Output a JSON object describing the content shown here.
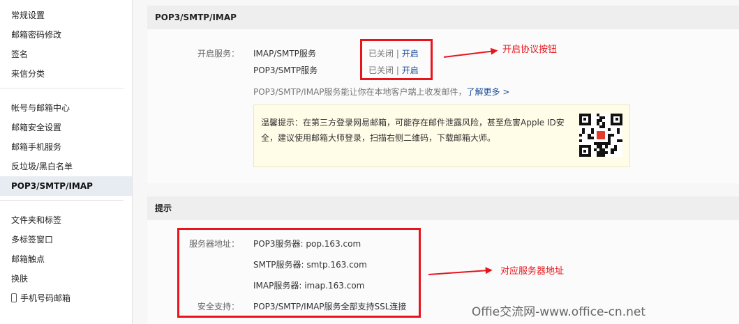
{
  "sidebar": {
    "group1": [
      "常规设置",
      "邮箱密码修改",
      "签名",
      "来信分类"
    ],
    "group2": [
      "帐号与邮箱中心",
      "邮箱安全设置",
      "邮箱手机服务",
      "反垃圾/黑白名单",
      "POP3/SMTP/IMAP"
    ],
    "group3": [
      "文件夹和标签",
      "多标签窗口",
      "邮箱触点",
      "换肤",
      "手机号码邮箱"
    ]
  },
  "pop_section": {
    "title": "POP3/SMTP/IMAP",
    "open_service_label": "开启服务：",
    "services": [
      {
        "name": "IMAP/SMTP服务",
        "status": "已关闭",
        "sep": "|",
        "action": "开启"
      },
      {
        "name": "POP3/SMTP服务",
        "status": "已关闭",
        "sep": "|",
        "action": "开启"
      }
    ],
    "desc": "POP3/SMTP/IMAP服务能让你在本地客户端上收发邮件，",
    "learn_more": "了解更多 >",
    "tip": "温馨提示：在第三方登录网易邮箱，可能存在邮件泄露风险，甚至危害Apple ID安全，建议使用邮箱大师登录，扫描右侧二维码，下载邮箱大师。"
  },
  "hint_section": {
    "title": "提示",
    "server_label": "服务器地址：",
    "servers": [
      "POP3服务器: pop.163.com",
      "SMTP服务器: smtp.163.com",
      "IMAP服务器: imap.163.com"
    ],
    "security_label": "安全支持：",
    "security_value": "POP3/SMTP/IMAP服务全部支持SSL连接"
  },
  "annotations": {
    "open_protocol": "开启协议按钮",
    "server_address": "对应服务器地址"
  },
  "watermark": "Offie交流网-www.office-cn.net",
  "colors": {
    "annotation_red": "#e8141b",
    "link_blue": "#1a4e9a",
    "sidebar_active_bg": "#e6ecf2",
    "tip_bg": "#fffce7"
  }
}
